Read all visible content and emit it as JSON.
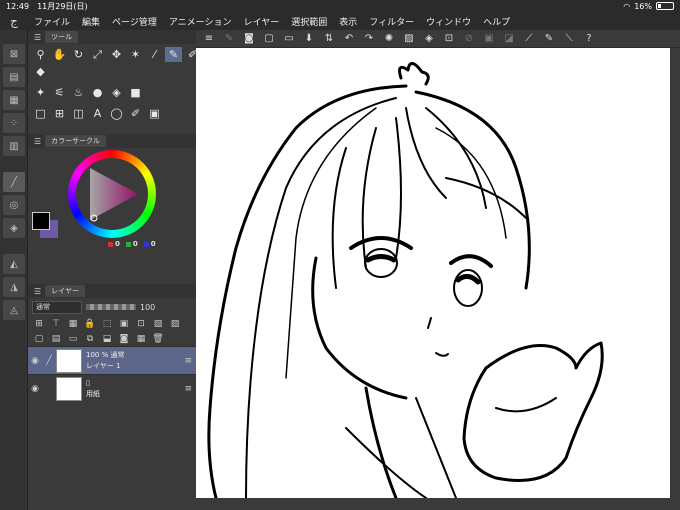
{
  "status": {
    "time": "12:49",
    "date": "11月29日(日)",
    "battery": "16%"
  },
  "menu": [
    "ファイル",
    "編集",
    "ページ管理",
    "アニメーション",
    "レイヤー",
    "選択範囲",
    "表示",
    "フィルター",
    "ウィンドウ",
    "ヘルプ"
  ],
  "tool_panel": {
    "tab": "ツール"
  },
  "color_panel": {
    "tab": "カラーサークル",
    "r": "0",
    "g": "0",
    "b": "0"
  },
  "layer_panel": {
    "tab": "レイヤー",
    "blend_mode": "通常",
    "opacity": "100",
    "layers": [
      {
        "line1": "100 % 通常",
        "line2": "レイヤー 1"
      },
      {
        "line1": "",
        "line2": "用紙"
      }
    ]
  },
  "colors": {
    "accent": "#5b6688",
    "main_color": "#000000",
    "sub_color": "#6e5aa6"
  }
}
